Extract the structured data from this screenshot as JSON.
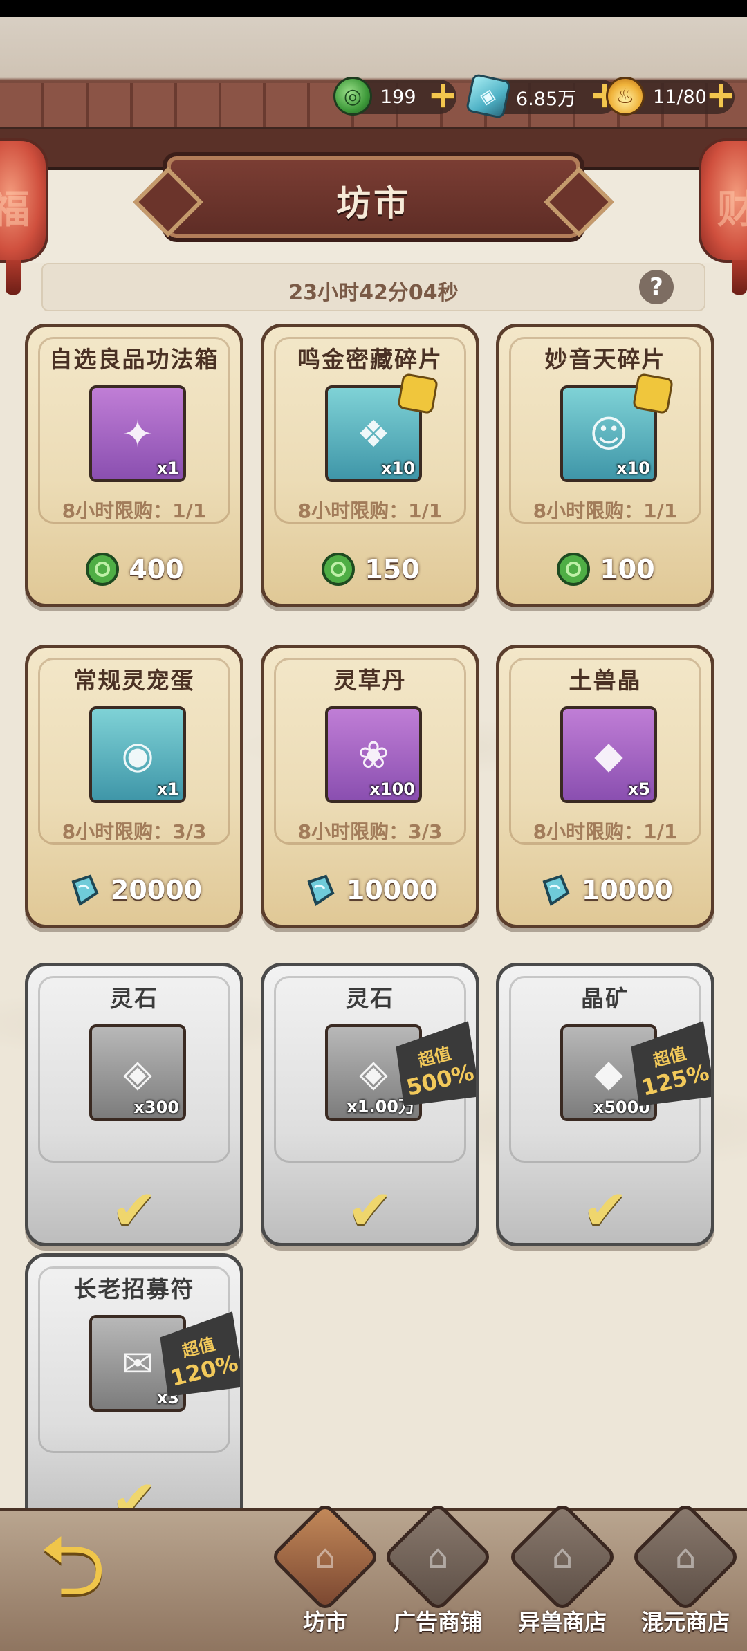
{
  "currencies": [
    {
      "name": "jade-coin",
      "value": "199"
    },
    {
      "name": "spirit-stone",
      "value": "6.85万"
    },
    {
      "name": "stamina",
      "value": "11/80"
    }
  ],
  "title": "坊市",
  "timer": "23小时42分04秒",
  "help_symbol": "?",
  "lantern_chars": [
    "福",
    "财"
  ],
  "items": [
    {
      "name": "自选良品功法箱",
      "qty": "x1",
      "limit": "8小时限购：1/1",
      "currency": "jade",
      "price": "400",
      "status": "available",
      "frame": "purple",
      "icon": "treasure-chest-icon",
      "glyph": "✦"
    },
    {
      "name": "鸣金密藏碎片",
      "qty": "x10",
      "limit": "8小时限购：1/1",
      "currency": "jade",
      "price": "150",
      "status": "available",
      "frame": "teal",
      "icon": "book-fragment-icon",
      "glyph": "❖",
      "puzzle": true
    },
    {
      "name": "妙音天碎片",
      "qty": "x10",
      "limit": "8小时限购：1/1",
      "currency": "jade",
      "price": "100",
      "status": "available",
      "frame": "teal",
      "icon": "hero-portrait-icon",
      "glyph": "☺",
      "puzzle": true
    },
    {
      "name": "常规灵宠蛋",
      "qty": "x1",
      "limit": "8小时限购：3/3",
      "currency": "stone",
      "price": "20000",
      "status": "available",
      "frame": "teal",
      "icon": "pet-egg-icon",
      "glyph": "◉"
    },
    {
      "name": "灵草丹",
      "qty": "x100",
      "limit": "8小时限购：3/3",
      "currency": "stone",
      "price": "10000",
      "status": "available",
      "frame": "purple",
      "icon": "herb-pill-icon",
      "glyph": "❀"
    },
    {
      "name": "土兽晶",
      "qty": "x5",
      "limit": "8小时限购：1/1",
      "currency": "stone",
      "price": "10000",
      "status": "available",
      "frame": "purple",
      "icon": "earth-crystal-icon",
      "glyph": "◆"
    },
    {
      "name": "灵石",
      "qty": "x300",
      "status": "sold",
      "frame": "gray",
      "icon": "spirit-stone-icon",
      "glyph": "◈"
    },
    {
      "name": "灵石",
      "qty": "x1.00万",
      "status": "sold",
      "frame": "gray",
      "icon": "spirit-stone-icon",
      "glyph": "◈",
      "badge_top": "超值",
      "badge_value": "500%"
    },
    {
      "name": "晶矿",
      "qty": "x5000",
      "status": "sold",
      "frame": "gray",
      "icon": "crystal-ore-icon",
      "glyph": "◆",
      "badge_top": "超值",
      "badge_value": "125%"
    },
    {
      "name": "长老招募符",
      "qty": "x3",
      "status": "sold",
      "frame": "gray",
      "icon": "recruit-talisman-icon",
      "glyph": "✉",
      "badge_top": "超值",
      "badge_value": "120%"
    }
  ],
  "nav": [
    {
      "label": "坊市",
      "active": true
    },
    {
      "label": "广告商铺",
      "active": false
    },
    {
      "label": "异兽商店",
      "active": false
    },
    {
      "label": "混元商店",
      "active": false
    }
  ],
  "colors": {
    "gold_accent": "#f3c64e",
    "jade_green": "#3e9a3a",
    "stone_blue": "#4fb2c6",
    "roof_brown": "#6b3d32"
  }
}
